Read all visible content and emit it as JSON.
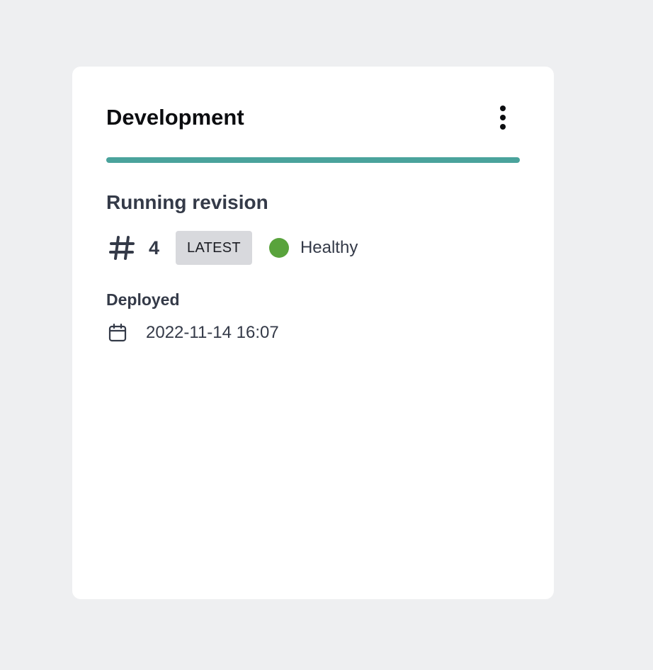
{
  "card": {
    "title": "Development",
    "more_icon": "more-vertical-icon",
    "environment_bar_color": "#4aa39c"
  },
  "revision": {
    "heading": "Running revision",
    "hash_icon": "hash-icon",
    "number": "4",
    "badge_label": "LATEST",
    "badge_color": "#d8d9dd",
    "status_label": "Healthy",
    "status_color": "#59a33c"
  },
  "deployment": {
    "label": "Deployed",
    "calendar_icon": "calendar-icon",
    "date": "2022-11-14 16:07"
  }
}
